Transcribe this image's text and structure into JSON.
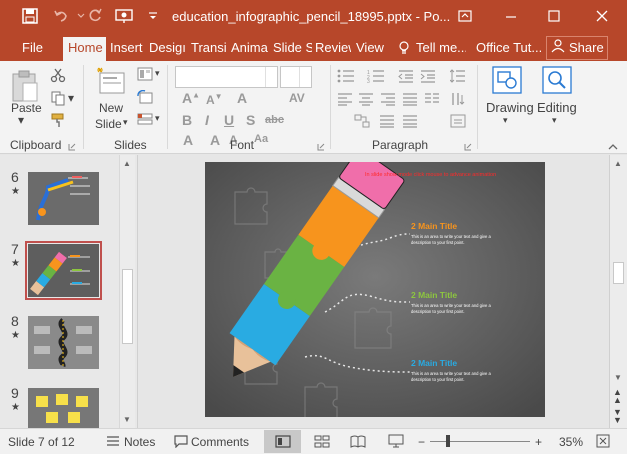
{
  "titlebar": {
    "document_title": "education_infographic_pencil_18995.pptx - Po...",
    "icons": [
      "save-icon",
      "undo-icon",
      "redo-icon",
      "present-from-start-icon",
      "customize-qat-icon",
      "ribbon-display-icon",
      "minimize-icon",
      "restore-icon",
      "close-icon"
    ]
  },
  "tabs": {
    "items": [
      "File",
      "Home",
      "Insert",
      "Design",
      "Transitions",
      "Animations",
      "Slide Show",
      "Review",
      "View"
    ],
    "visible": [
      "File",
      "Home",
      "Insert",
      "Desigı",
      "Transi",
      "Anima",
      "Slide S",
      "Review",
      "View"
    ],
    "tell_me": "Tell me...",
    "account": "Office Tut...",
    "share": "Share",
    "active": "Home"
  },
  "ribbon": {
    "clipboard": {
      "paste": "Paste",
      "label": "Clipboard"
    },
    "slides": {
      "new_slide": "New",
      "new_slide_2": "Slide",
      "label": "Slides"
    },
    "font": {
      "label": "Font"
    },
    "paragraph": {
      "label": "Paragraph"
    },
    "drawing": {
      "label": "Drawing"
    },
    "editing": {
      "label": "Editing"
    }
  },
  "thumbnails": [
    {
      "number": "6",
      "star": "★"
    },
    {
      "number": "7",
      "star": "★"
    },
    {
      "number": "8",
      "star": "★"
    },
    {
      "number": "9",
      "star": "★"
    }
  ],
  "slide": {
    "hint": "In slide show mode click mouse to advance animation",
    "items": [
      {
        "title": "2 Main Title",
        "text1": "This is an area to write your text and give a",
        "text2": "description to your first point.",
        "color": "#f7941d"
      },
      {
        "title": "2 Main Title",
        "text1": "This is an area to write your text and give a",
        "text2": "description to your first point.",
        "color": "#8dc63f"
      },
      {
        "title": "2 Main Title",
        "text1": "This is an area to write your text and give a",
        "text2": "description to your first point.",
        "color": "#29abe2"
      }
    ],
    "colors": {
      "eraser": "#f06eaa",
      "orange": "#f7941d",
      "green": "#6ab343",
      "blue": "#29abe2",
      "wood": "#e8c19a",
      "background": "#5a5a5a"
    }
  },
  "statusbar": {
    "slide_info": "Slide 7 of 12",
    "notes": "Notes",
    "comments": "Comments",
    "zoom": "35%"
  },
  "theme": {
    "accent": "#b7472a",
    "ribbon_bg": "#f3f3f3"
  }
}
